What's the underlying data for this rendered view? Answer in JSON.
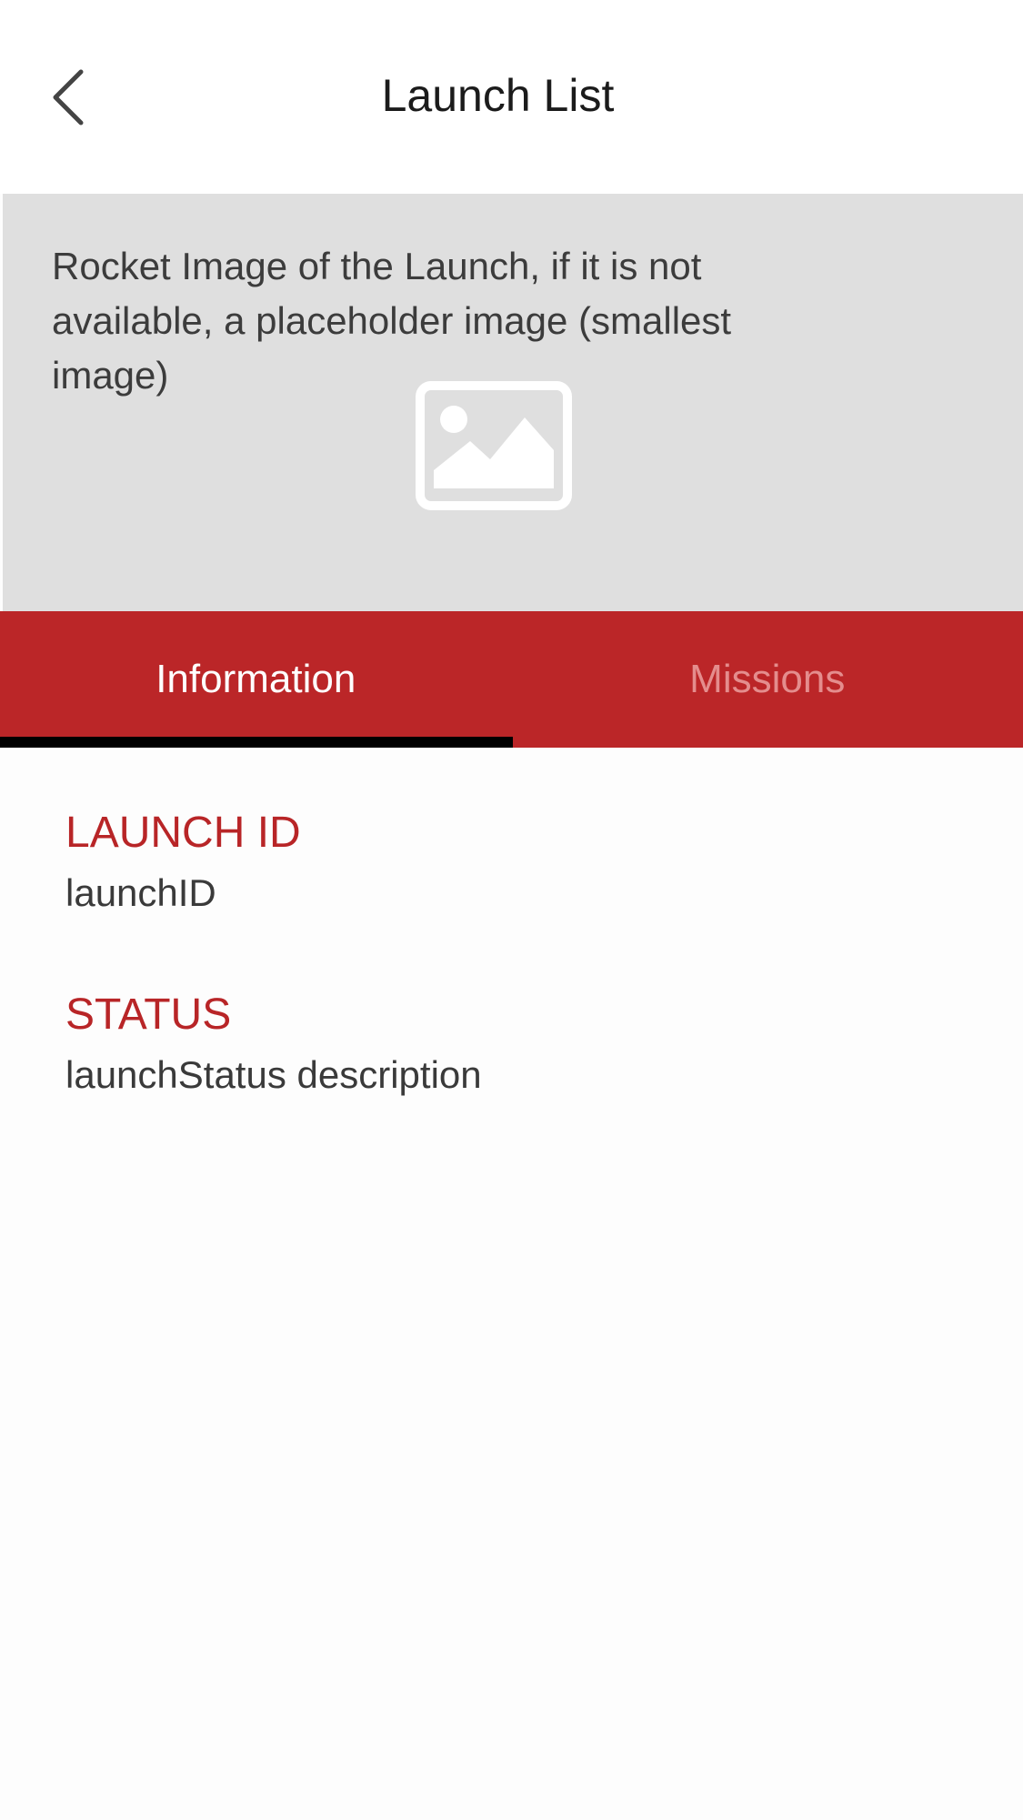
{
  "navbar": {
    "title": "Launch List",
    "back_icon": "chevron-left-icon"
  },
  "hero": {
    "caption": "Rocket Image of the Launch, if it is not available, a placeholder image (smallest image)",
    "placeholder_icon": "image-placeholder-icon"
  },
  "tabs": [
    {
      "label": "Information",
      "active": true
    },
    {
      "label": "Missions",
      "active": false
    }
  ],
  "details": {
    "launch_id": {
      "label": "LAUNCH ID",
      "value": "launchID"
    },
    "status": {
      "label": "STATUS",
      "value": "launchStatus description"
    }
  },
  "colors": {
    "accent": "#bb2628",
    "label": "#b82527",
    "tab_inactive": "#e48d8d",
    "hero_bg": "#dfdfdf",
    "indicator": "#000000"
  }
}
